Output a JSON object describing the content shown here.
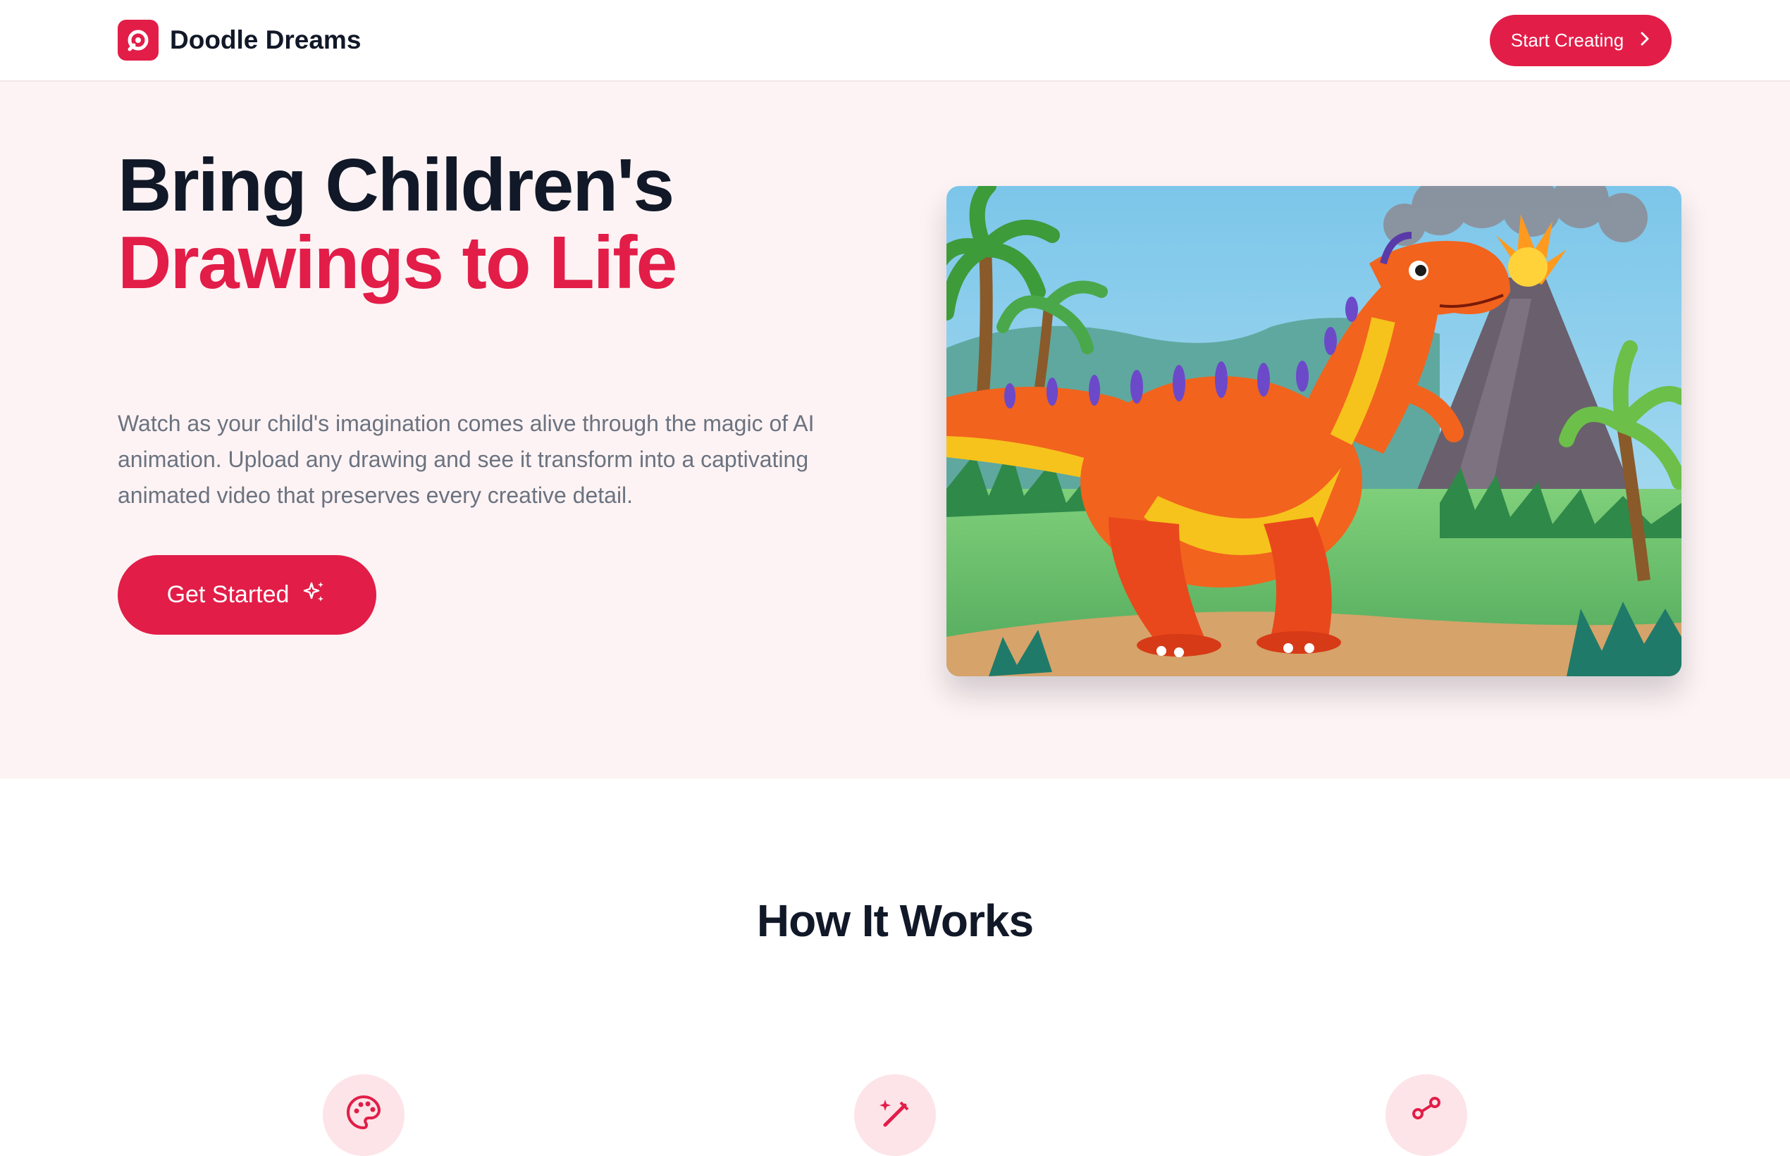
{
  "nav": {
    "brand_name": "Doodle Dreams",
    "logo_icon": "doodle-logo-icon",
    "cta_label": "Start Creating",
    "cta_icon": "chevron-right-icon"
  },
  "hero": {
    "title_line1": "Bring Children's",
    "title_line2": "Drawings to Life",
    "subtitle": "Watch as your child's imagination comes alive through the magic of AI animation. Upload any drawing and see it transform into a captivating animated video that preserves every creative detail.",
    "button_label": "Get Started",
    "button_icon": "sparkles-icon",
    "illustration": "dinosaur-volcano-drawing"
  },
  "how_it_works": {
    "heading": "How It Works",
    "step_icons": [
      "palette-icon",
      "magic-wand-icon",
      "share-icon"
    ]
  },
  "colors": {
    "accent": "#e11d48",
    "hero_bg": "#fdf3f4",
    "heading": "#111827",
    "body_text": "#6b7280"
  }
}
